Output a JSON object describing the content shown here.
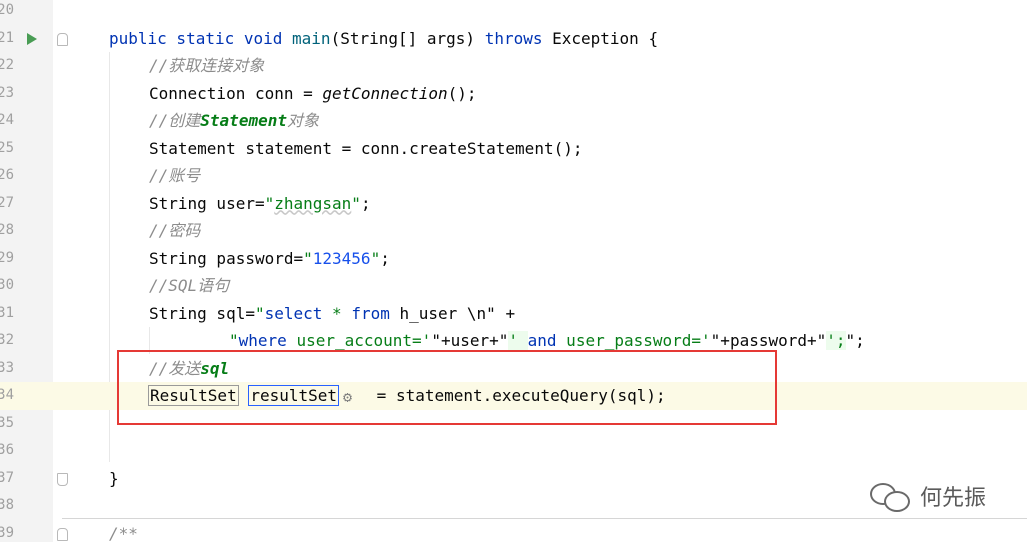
{
  "editor": {
    "lines": [
      {
        "number": "20"
      },
      {
        "number": "21"
      },
      {
        "number": "22"
      },
      {
        "number": "23"
      },
      {
        "number": "24"
      },
      {
        "number": "25"
      },
      {
        "number": "26"
      },
      {
        "number": "27"
      },
      {
        "number": "28"
      },
      {
        "number": "29"
      },
      {
        "number": "30"
      },
      {
        "number": "31"
      },
      {
        "number": "32"
      },
      {
        "number": "33"
      },
      {
        "number": "34"
      },
      {
        "number": "35"
      },
      {
        "number": "36"
      },
      {
        "number": "37"
      },
      {
        "number": "38"
      },
      {
        "number": "39"
      }
    ],
    "code": {
      "l21": {
        "kw1": "public static void ",
        "method": "main",
        "params": "(String[] args) ",
        "throws": "throws",
        "exception": " Exception {"
      },
      "l22": {
        "comment_prefix": "//",
        "comment_text": "获取连接对象"
      },
      "l23": {
        "pre": "Connection conn = ",
        "call": "getConnection",
        "post": "();"
      },
      "l24": {
        "comment_prefix": "//",
        "comment_mid": "创建",
        "comment_word": "Statement",
        "comment_end": "对象"
      },
      "l25": {
        "text": "Statement statement = conn.createStatement();"
      },
      "l26": {
        "comment_prefix": "//",
        "comment_text": "账号"
      },
      "l27": {
        "pre": "String user=",
        "q1": "\"",
        "value": "zhangsan",
        "q2": "\"",
        "post": ";"
      },
      "l28": {
        "comment_prefix": "//",
        "comment_text": "密码"
      },
      "l29": {
        "pre": "String password=",
        "q1": "\"",
        "value": "123456",
        "q2": "\"",
        "post": ";"
      },
      "l30": {
        "comment_prefix": "//SQL",
        "comment_text": "语句"
      },
      "l31": {
        "pre": "String sql=",
        "q": "\"",
        "kw_select": "select",
        "mid1": " * ",
        "kw_from": "from",
        "mid2": " h_user \\n\" +"
      },
      "l32": {
        "s1": "\"",
        "kw_where": "where",
        "s2": " user_account='",
        "p1": "\"+user+\"",
        "s3": "' ",
        "kw_and": "and",
        "s4": " user_password='",
        "p2": "\"+password+\"",
        "s5": "'",
        "s6": ";",
        "end": "\";"
      },
      "l33": {
        "comment_prefix": "//",
        "comment_text": "发送",
        "comment_word": "sql"
      },
      "l34": {
        "type_box": "ResultSet",
        "var_box": "resultSet",
        "gear": "⚙",
        "rest": " = statement.executeQuery(sql);"
      },
      "l37": {
        "text": "}"
      },
      "l39": {
        "text": "/**"
      }
    }
  },
  "watermark": {
    "text": "何先振",
    "icon": "wechat-icon"
  },
  "colors": {
    "keyword": "#0033b3",
    "string": "#067d17",
    "number": "#1750eb",
    "comment": "#8c8c8c",
    "highlight_box": "#e53935",
    "current_line": "#fcfae6"
  }
}
